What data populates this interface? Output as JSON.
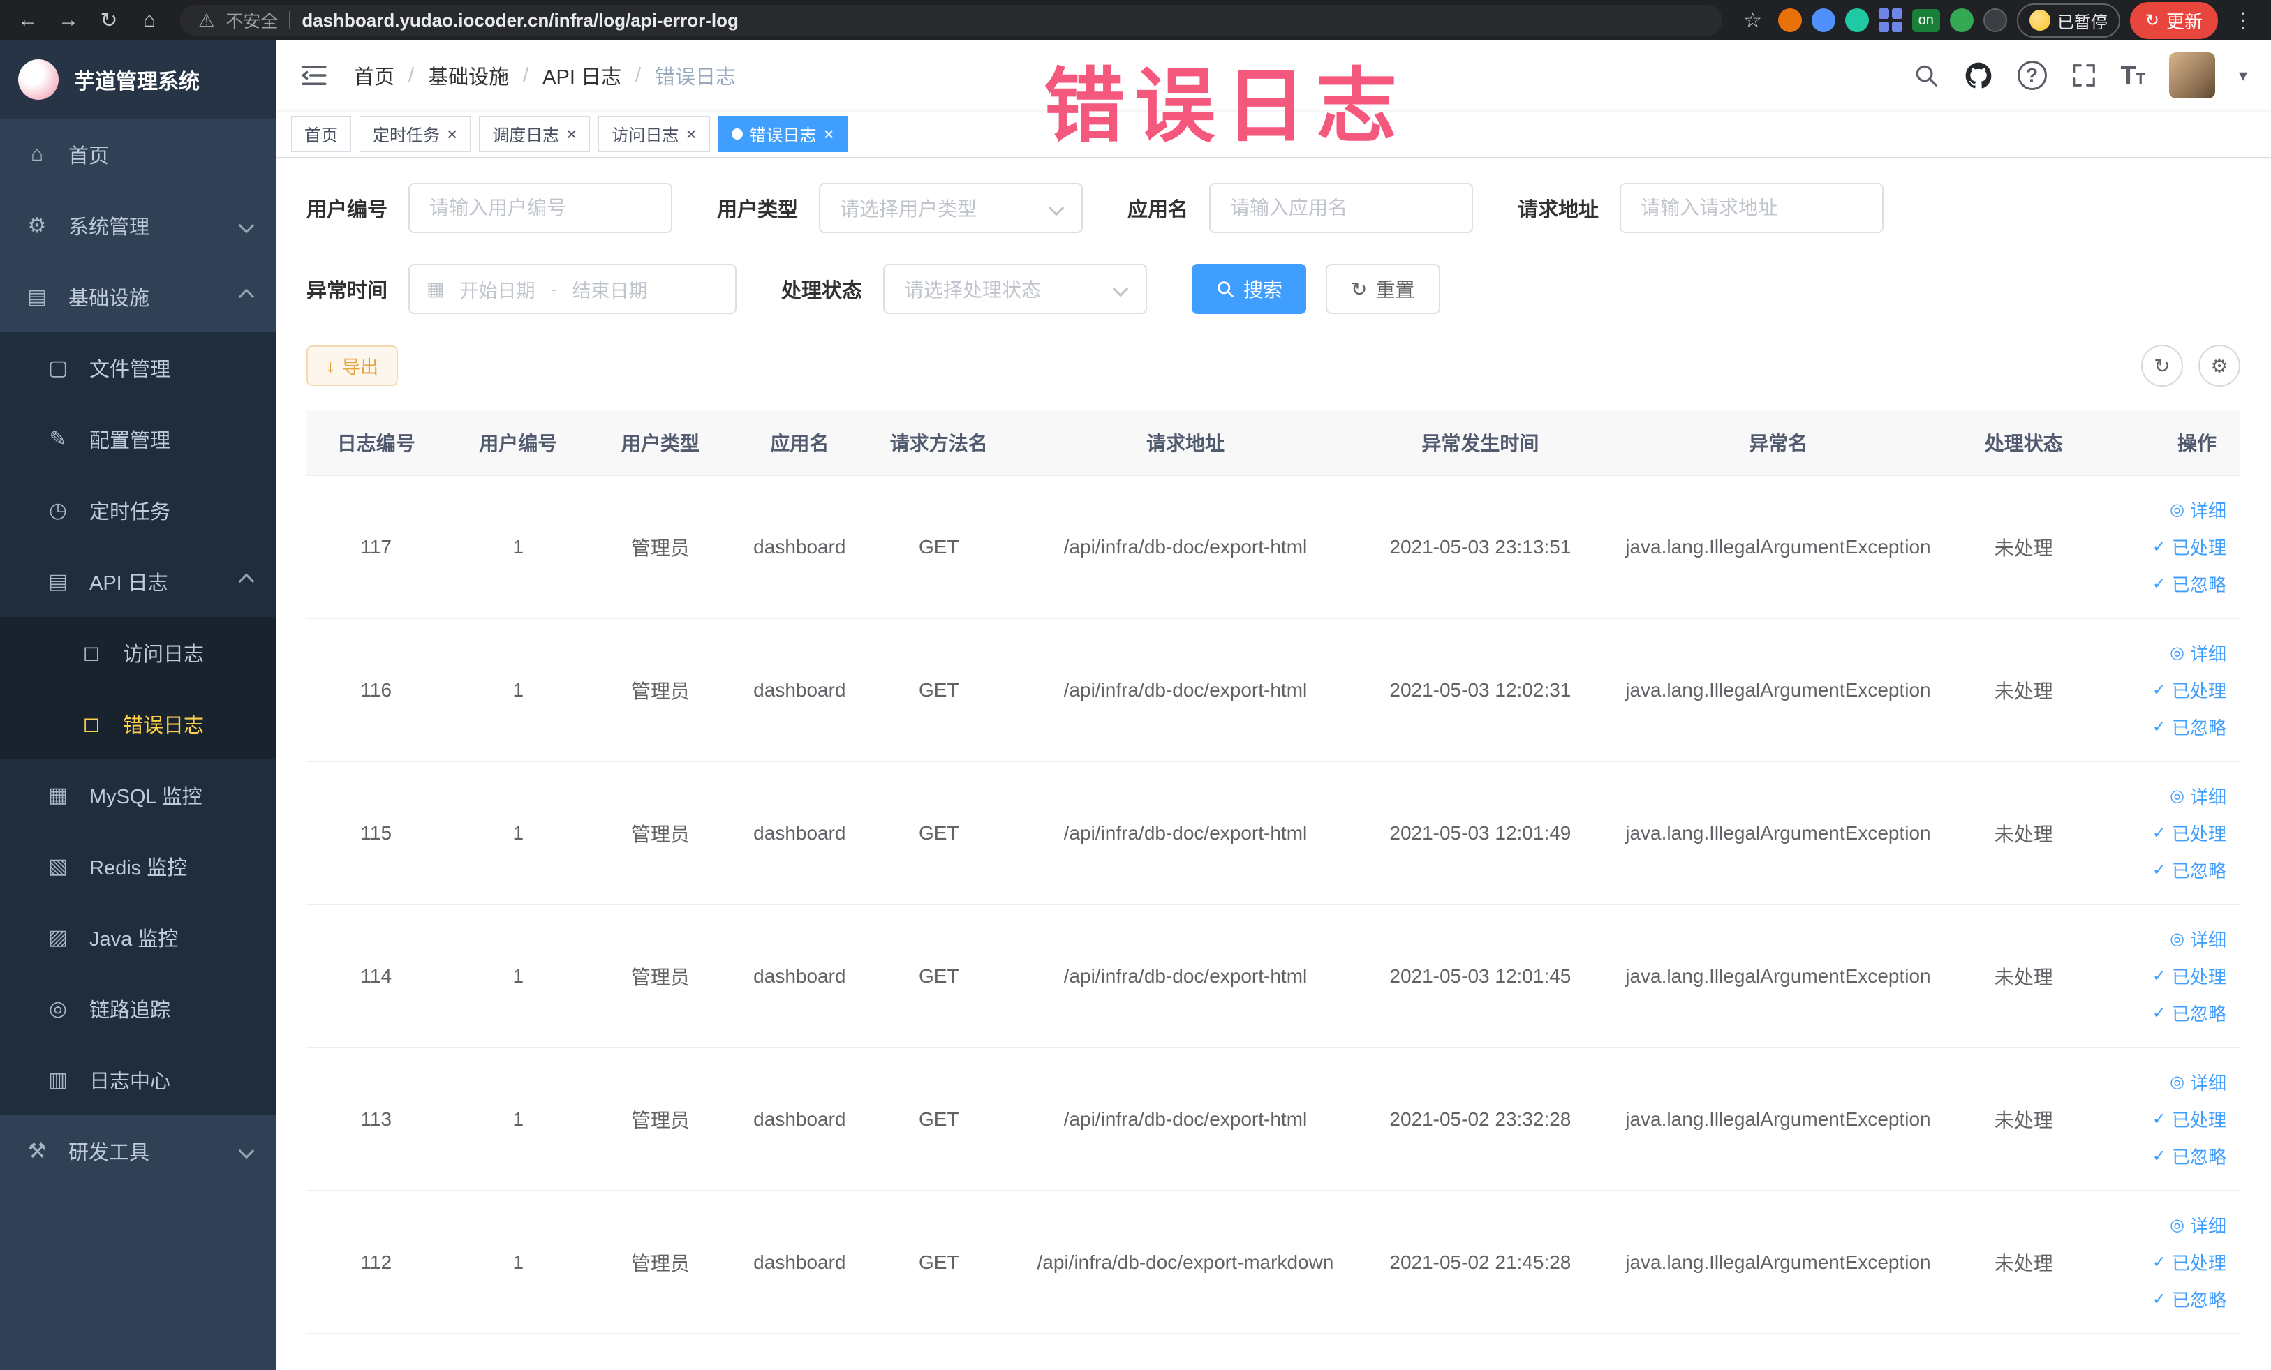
{
  "watermark": "错误日志",
  "colors": {
    "accent": "#409eff",
    "sidebar_active": "#ffd04b",
    "watermark": "#f3426b",
    "warning_button": "#e6a23c"
  },
  "browser": {
    "security_label": "不安全",
    "url": "dashboard.yudao.iocoder.cn/infra/log/api-error-log",
    "paused_label": "已暂停",
    "update_label": "更新",
    "on_badge": "on"
  },
  "icons": {
    "back": "←",
    "forward": "→",
    "reload": "↻",
    "home": "⌂",
    "warning": "⚠",
    "star": "☆",
    "dots": "⋮",
    "caret": "▾",
    "close": "×",
    "check": "✓",
    "eye": "◎",
    "download": "↓",
    "calendar": "▦",
    "refresh": "↻",
    "gear": "⚙",
    "question": "?",
    "fontsize_big": "T",
    "fontsize_small": "T",
    "sidebar": {
      "home": "⌂",
      "system": "⚙",
      "infra": "▤",
      "file": "▢",
      "config": "✎",
      "job": "◷",
      "apilog": "▤",
      "doc": "◻",
      "mysql": "▦",
      "redis": "▧",
      "java": "▨",
      "trace": "◎",
      "logcenter": "▥",
      "tools": "⚒"
    }
  },
  "sidebar": {
    "logo_title": "芋道管理系统",
    "menu": [
      {
        "key": "home",
        "label": "首页",
        "icon": "home"
      },
      {
        "key": "system",
        "label": "系统管理",
        "icon": "system",
        "children": [],
        "expanded": false
      },
      {
        "key": "infra",
        "label": "基础设施",
        "icon": "infra",
        "expanded": true,
        "children": [
          {
            "key": "file",
            "label": "文件管理",
            "icon": "file"
          },
          {
            "key": "config",
            "label": "配置管理",
            "icon": "config"
          },
          {
            "key": "job",
            "label": "定时任务",
            "icon": "job"
          },
          {
            "key": "api-log",
            "label": "API 日志",
            "icon": "apilog",
            "expanded": true,
            "children": [
              {
                "key": "access-log",
                "label": "访问日志",
                "icon": "doc"
              },
              {
                "key": "error-log",
                "label": "错误日志",
                "icon": "doc",
                "active": true
              }
            ]
          },
          {
            "key": "mysql",
            "label": "MySQL 监控",
            "icon": "mysql"
          },
          {
            "key": "redis",
            "label": "Redis 监控",
            "icon": "redis"
          },
          {
            "key": "java",
            "label": "Java 监控",
            "icon": "java"
          },
          {
            "key": "trace",
            "label": "链路追踪",
            "icon": "trace"
          },
          {
            "key": "log-center",
            "label": "日志中心",
            "icon": "logcenter"
          }
        ]
      },
      {
        "key": "dev-tools",
        "label": "研发工具",
        "icon": "tools",
        "children": [],
        "expanded": false
      }
    ]
  },
  "breadcrumb": [
    "首页",
    "基础设施",
    "API 日志",
    "错误日志"
  ],
  "tabs": [
    {
      "label": "首页",
      "closable": false,
      "active": false
    },
    {
      "label": "定时任务",
      "closable": true,
      "active": false
    },
    {
      "label": "调度日志",
      "closable": true,
      "active": false
    },
    {
      "label": "访问日志",
      "closable": true,
      "active": false
    },
    {
      "label": "错误日志",
      "closable": true,
      "active": true
    }
  ],
  "filters": {
    "user_id": {
      "label": "用户编号",
      "placeholder": "请输入用户编号"
    },
    "user_type": {
      "label": "用户类型",
      "placeholder": "请选择用户类型"
    },
    "app_name": {
      "label": "应用名",
      "placeholder": "请输入应用名"
    },
    "request_url": {
      "label": "请求地址",
      "placeholder": "请输入请求地址"
    },
    "exception_time": {
      "label": "异常时间",
      "start_placeholder": "开始日期",
      "end_placeholder": "结束日期",
      "range_separator": "-"
    },
    "process_status": {
      "label": "处理状态",
      "placeholder": "请选择处理状态"
    },
    "search_label": "搜索",
    "reset_label": "重置"
  },
  "toolbar": {
    "export_label": "导出"
  },
  "table": {
    "headers": [
      "日志编号",
      "用户编号",
      "用户类型",
      "应用名",
      "请求方法名",
      "请求地址",
      "异常发生时间",
      "异常名",
      "处理状态",
      "操作"
    ],
    "action_labels": [
      "详细",
      "已处理",
      "已忽略"
    ],
    "rows": [
      [
        "117",
        "1",
        "管理员",
        "dashboard",
        "GET",
        "/api/infra/db-doc/export-html",
        "2021-05-03 23:13:51",
        "java.lang.IllegalArgumentException",
        "未处理"
      ],
      [
        "116",
        "1",
        "管理员",
        "dashboard",
        "GET",
        "/api/infra/db-doc/export-html",
        "2021-05-03 12:02:31",
        "java.lang.IllegalArgumentException",
        "未处理"
      ],
      [
        "115",
        "1",
        "管理员",
        "dashboard",
        "GET",
        "/api/infra/db-doc/export-html",
        "2021-05-03 12:01:49",
        "java.lang.IllegalArgumentException",
        "未处理"
      ],
      [
        "114",
        "1",
        "管理员",
        "dashboard",
        "GET",
        "/api/infra/db-doc/export-html",
        "2021-05-03 12:01:45",
        "java.lang.IllegalArgumentException",
        "未处理"
      ],
      [
        "113",
        "1",
        "管理员",
        "dashboard",
        "GET",
        "/api/infra/db-doc/export-html",
        "2021-05-02 23:32:28",
        "java.lang.IllegalArgumentException",
        "未处理"
      ],
      [
        "112",
        "1",
        "管理员",
        "dashboard",
        "GET",
        "/api/infra/db-doc/export-markdown",
        "2021-05-02 21:45:28",
        "java.lang.IllegalArgumentException",
        "未处理"
      ]
    ]
  }
}
